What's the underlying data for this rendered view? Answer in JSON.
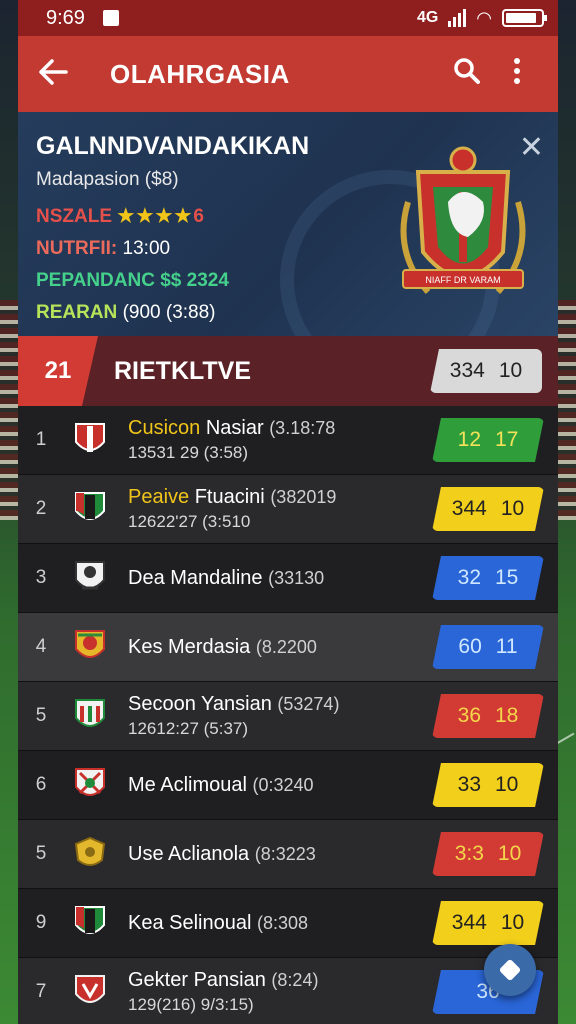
{
  "status": {
    "time": "9:69",
    "network": "4G"
  },
  "appbar": {
    "title": "OLAHRGASIA",
    "back_icon": "arrow-left-icon",
    "search_icon": "search-icon",
    "menu_icon": "more-vertical-icon"
  },
  "hero": {
    "title": "GALNNDVANDAKIKAN",
    "subtitle": "Madapasion ($8)",
    "line1_label": "NSZALE",
    "line1_stars": "★★★★",
    "line1_value": "6",
    "line2_label": "NUTRFII:",
    "line2_value": "13:00",
    "line3": "PEPANDANC $$ 2324",
    "line4_label": "REARAN",
    "line4_value": "(900 (3:88)",
    "crest_text": "NIAFF DR VARAM"
  },
  "section": {
    "rank": "21",
    "label": "RIETKLTVE",
    "score_a": "334",
    "score_b": "10"
  },
  "rows": [
    {
      "pos": "1",
      "name": "Cusicon",
      "name_rest": " Nasiar",
      "meta": "(3.18:78",
      "meta2": "13531 29  (3:58)",
      "a": "12",
      "b": "17",
      "color": "green",
      "shade": "",
      "crest": "red-white"
    },
    {
      "pos": "2",
      "name": "Peaive",
      "name_rest": " Ftuacini",
      "meta": "(382019",
      "meta2": "12622'27  (3:510",
      "a": "344",
      "b": "10",
      "color": "yellow",
      "shade": "alt",
      "crest": "green-red"
    },
    {
      "pos": "3",
      "name": "",
      "name_rest": "Dea Mandaline",
      "meta": "(33130",
      "meta2": "",
      "a": "32",
      "b": "15",
      "color": "blue",
      "shade": "",
      "crest": "white-figure"
    },
    {
      "pos": "4",
      "name": "",
      "name_rest": "Kes Merdasia",
      "meta": "(8.2200",
      "meta2": "",
      "a": "60",
      "b": "11",
      "color": "blue",
      "shade": "hl",
      "crest": "yellow-red"
    },
    {
      "pos": "5",
      "name": "",
      "name_rest": "Secoon Yansian",
      "meta": "(53274)",
      "meta2": "12612:27  (5:37)",
      "a": "36",
      "b": "18",
      "color": "red",
      "shade": "alt",
      "crest": "green-red-stripes"
    },
    {
      "pos": "6",
      "name": "",
      "name_rest": "Me Aclimoual",
      "meta": "(0:3240",
      "meta2": "",
      "a": "33",
      "b": "10",
      "color": "yellow",
      "shade": "",
      "crest": "white-red"
    },
    {
      "pos": "5",
      "name": "",
      "name_rest": "Use Aclianola",
      "meta": "(8:3223",
      "meta2": "",
      "a": "3:3",
      "b": "10",
      "color": "red",
      "shade": "alt",
      "crest": "gold"
    },
    {
      "pos": "9",
      "name": "",
      "name_rest": "Kea Selinoual",
      "meta": "(8:308",
      "meta2": "",
      "a": "344",
      "b": "10",
      "color": "yellow",
      "shade": "",
      "crest": "green-red"
    },
    {
      "pos": "7",
      "name": "",
      "name_rest": "Gekter Pansian",
      "meta": "(8:24)",
      "meta2": "129(216) 9/3:15)",
      "a": "36",
      "b": "",
      "color": "blue",
      "shade": "alt",
      "crest": "red-shield"
    }
  ],
  "colors": {
    "primary": "#c33a33",
    "dark": "#1f1f22",
    "hero": "#253c5c"
  }
}
